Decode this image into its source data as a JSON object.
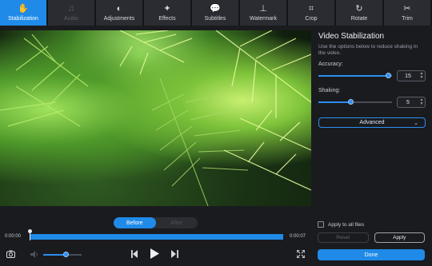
{
  "toolbar": {
    "tools": [
      {
        "label": "Stabilization",
        "icon": "hand-stabilize-icon",
        "state": "active"
      },
      {
        "label": "Audio",
        "icon": "music-note-icon",
        "state": "disabled"
      },
      {
        "label": "Adjustments",
        "icon": "contrast-circle-icon",
        "state": "normal"
      },
      {
        "label": "Effects",
        "icon": "magic-wand-icon",
        "state": "normal"
      },
      {
        "label": "Subtitles",
        "icon": "speech-bubble-icon",
        "state": "normal"
      },
      {
        "label": "Watermark",
        "icon": "stamp-icon",
        "state": "normal"
      },
      {
        "label": "Crop",
        "icon": "crop-icon",
        "state": "normal"
      },
      {
        "label": "Rotate",
        "icon": "rotate-icon",
        "state": "normal"
      },
      {
        "label": "Trim",
        "icon": "scissors-icon",
        "state": "normal"
      }
    ]
  },
  "panel": {
    "title": "Video Stabilization",
    "description": "Use the options below to reduce shaking in the video.",
    "accuracy": {
      "label": "Accuracy:",
      "value": "15",
      "fraction": 0.96
    },
    "shaking": {
      "label": "Shaking:",
      "value": "5",
      "fraction": 0.45
    },
    "advanced_label": "Advanced",
    "apply_all_label": "Apply to all files",
    "reset_label": "Reset",
    "apply_label": "Apply",
    "done_label": "Done"
  },
  "preview": {
    "before_label": "Before",
    "after_label": "After",
    "time_start": "0:00:00",
    "time_end": "0:00:07",
    "volume_fraction": 0.6
  },
  "colors": {
    "accent": "#1f8ae8",
    "background": "#1a1b1f",
    "tool_bg": "#2a2c31"
  }
}
